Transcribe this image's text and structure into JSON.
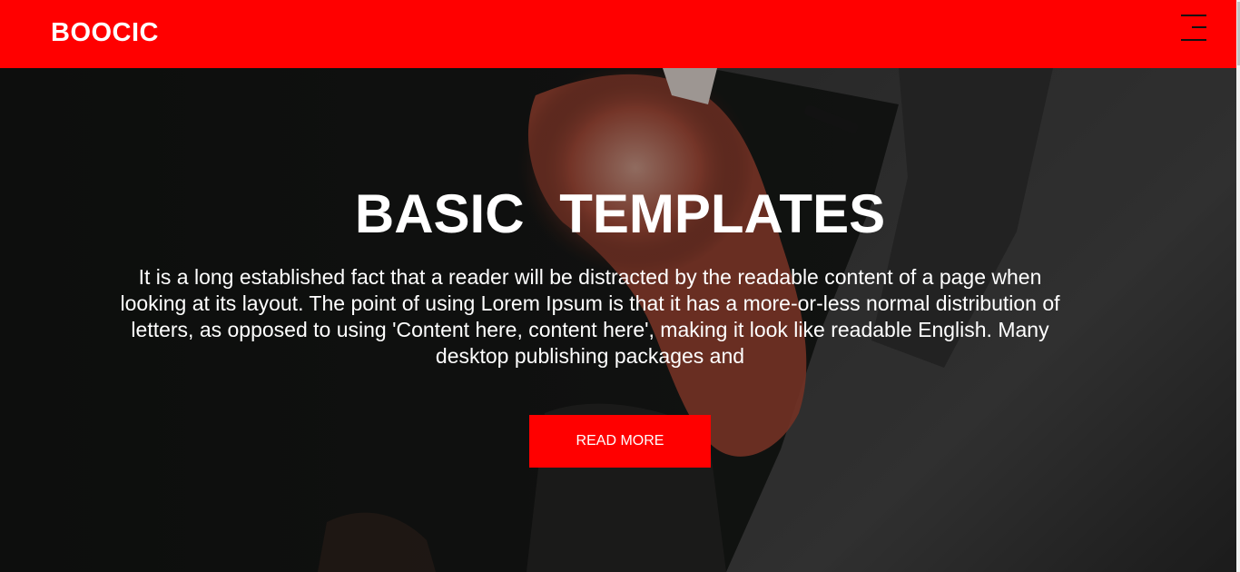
{
  "header": {
    "logo": "BOOCIC",
    "background_color": "#ff0000",
    "menu_icon": "hamburger-menu-icon"
  },
  "hero": {
    "title": "BASIC TEMPLATES",
    "text": "It is a long established fact that a reader will be distracted by the readable content of a page when looking at its layout. The point of using Lorem Ipsum is that it has a more-or-less normal distribution of letters, as opposed to using 'Content here, content here', making it look like readable English. Many desktop publishing packages and",
    "button_label": "READ MORE",
    "button_color": "#ff0000"
  }
}
